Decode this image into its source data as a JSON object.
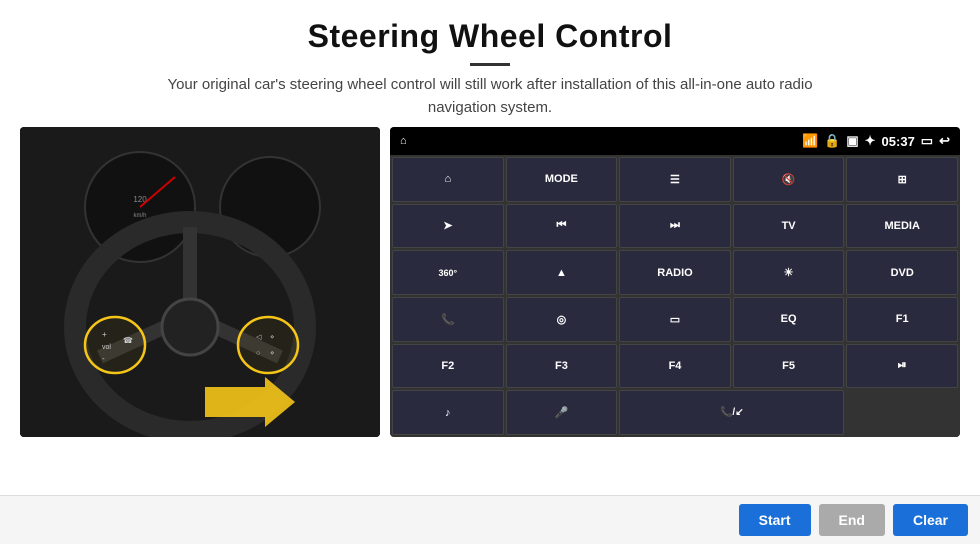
{
  "header": {
    "title": "Steering Wheel Control",
    "description": "Your original car's steering wheel control will still work after installation of this all-in-one auto radio navigation system."
  },
  "statusBar": {
    "time": "05:37",
    "icons": [
      "wifi",
      "lock",
      "sim",
      "bluetooth",
      "screen",
      "back"
    ]
  },
  "gridButtons": [
    {
      "id": "home",
      "label": "⌂",
      "type": "icon"
    },
    {
      "id": "mode",
      "label": "MODE",
      "type": "text"
    },
    {
      "id": "menu-list",
      "label": "≡",
      "type": "icon"
    },
    {
      "id": "mute",
      "label": "🔇",
      "type": "icon"
    },
    {
      "id": "apps",
      "label": "⊞",
      "type": "icon"
    },
    {
      "id": "navigate",
      "label": "➤",
      "type": "icon"
    },
    {
      "id": "prev",
      "label": "◄◄",
      "type": "icon"
    },
    {
      "id": "next",
      "label": "►►",
      "type": "icon"
    },
    {
      "id": "tv",
      "label": "TV",
      "type": "text"
    },
    {
      "id": "media",
      "label": "MEDIA",
      "type": "text"
    },
    {
      "id": "cam360",
      "label": "360°",
      "type": "text"
    },
    {
      "id": "eject",
      "label": "▲",
      "type": "icon"
    },
    {
      "id": "radio",
      "label": "RADIO",
      "type": "text"
    },
    {
      "id": "brightness",
      "label": "☀",
      "type": "icon"
    },
    {
      "id": "dvd",
      "label": "DVD",
      "type": "text"
    },
    {
      "id": "phone",
      "label": "📞",
      "type": "icon"
    },
    {
      "id": "navi",
      "label": "◎",
      "type": "icon"
    },
    {
      "id": "screen-mirror",
      "label": "▭",
      "type": "icon"
    },
    {
      "id": "eq",
      "label": "EQ",
      "type": "text"
    },
    {
      "id": "f1",
      "label": "F1",
      "type": "text"
    },
    {
      "id": "f2",
      "label": "F2",
      "type": "text"
    },
    {
      "id": "f3",
      "label": "F3",
      "type": "text"
    },
    {
      "id": "f4",
      "label": "F4",
      "type": "text"
    },
    {
      "id": "f5",
      "label": "F5",
      "type": "text"
    },
    {
      "id": "play-pause",
      "label": "►II",
      "type": "icon"
    },
    {
      "id": "music",
      "label": "♪",
      "type": "icon"
    },
    {
      "id": "mic",
      "label": "🎤",
      "type": "icon"
    },
    {
      "id": "phone-end",
      "label": "📞/↙",
      "type": "icon",
      "span": 2
    }
  ],
  "bottomBar": {
    "startLabel": "Start",
    "endLabel": "End",
    "clearLabel": "Clear"
  }
}
